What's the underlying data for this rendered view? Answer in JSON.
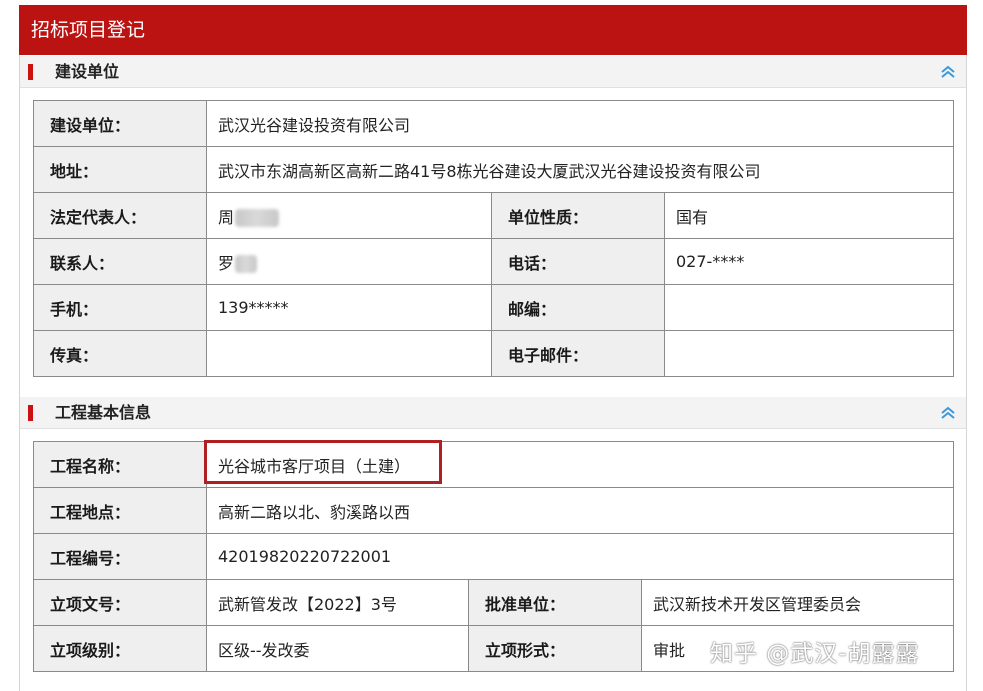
{
  "page": {
    "title": "招标项目登记"
  },
  "section1": {
    "title": "建设单位",
    "collapse_icon": "double-chevron-up-icon",
    "rows": {
      "unit": {
        "label": "建设单位：",
        "value": "武汉光谷建设投资有限公司"
      },
      "address": {
        "label": "地址：",
        "value": "武汉市东湖高新区高新二路41号8栋光谷建设大厦武汉光谷建设投资有限公司"
      },
      "legal_rep": {
        "label": "法定代表人：",
        "value": "周"
      },
      "unit_type": {
        "label": "单位性质：",
        "value": "国有"
      },
      "contact": {
        "label": "联系人：",
        "value": "罗"
      },
      "phone": {
        "label": "电话：",
        "value": "027-****"
      },
      "mobile": {
        "label": "手机：",
        "value": "139*****"
      },
      "postcode": {
        "label": "邮编：",
        "value": ""
      },
      "fax": {
        "label": "传真：",
        "value": ""
      },
      "email": {
        "label": "电子邮件：",
        "value": ""
      }
    }
  },
  "section2": {
    "title": "工程基本信息",
    "collapse_icon": "double-chevron-up-icon",
    "rows": {
      "name": {
        "label": "工程名称：",
        "value": "光谷城市客厅项目（土建）"
      },
      "location": {
        "label": "工程地点：",
        "value": "高新二路以北、豹溪路以西"
      },
      "code": {
        "label": "工程编号：",
        "value": "42019820220722001"
      },
      "approval_doc": {
        "label": "立项文号：",
        "value": "武新管发改【2022】3号"
      },
      "approval_unit": {
        "label": "批准单位：",
        "value": "武汉新技术开发区管理委员会"
      },
      "level": {
        "label": "立项级别：",
        "value": "区级--发改委"
      },
      "form": {
        "label": "立项形式：",
        "value": "审批"
      }
    }
  },
  "watermark": "知乎 @武汉-胡露露",
  "colors": {
    "header_red": "#bb1212",
    "accent_bar": "#cc1111",
    "highlight_border": "#b02020",
    "label_bg": "#efefef",
    "chevron": "#3a9ad9"
  }
}
